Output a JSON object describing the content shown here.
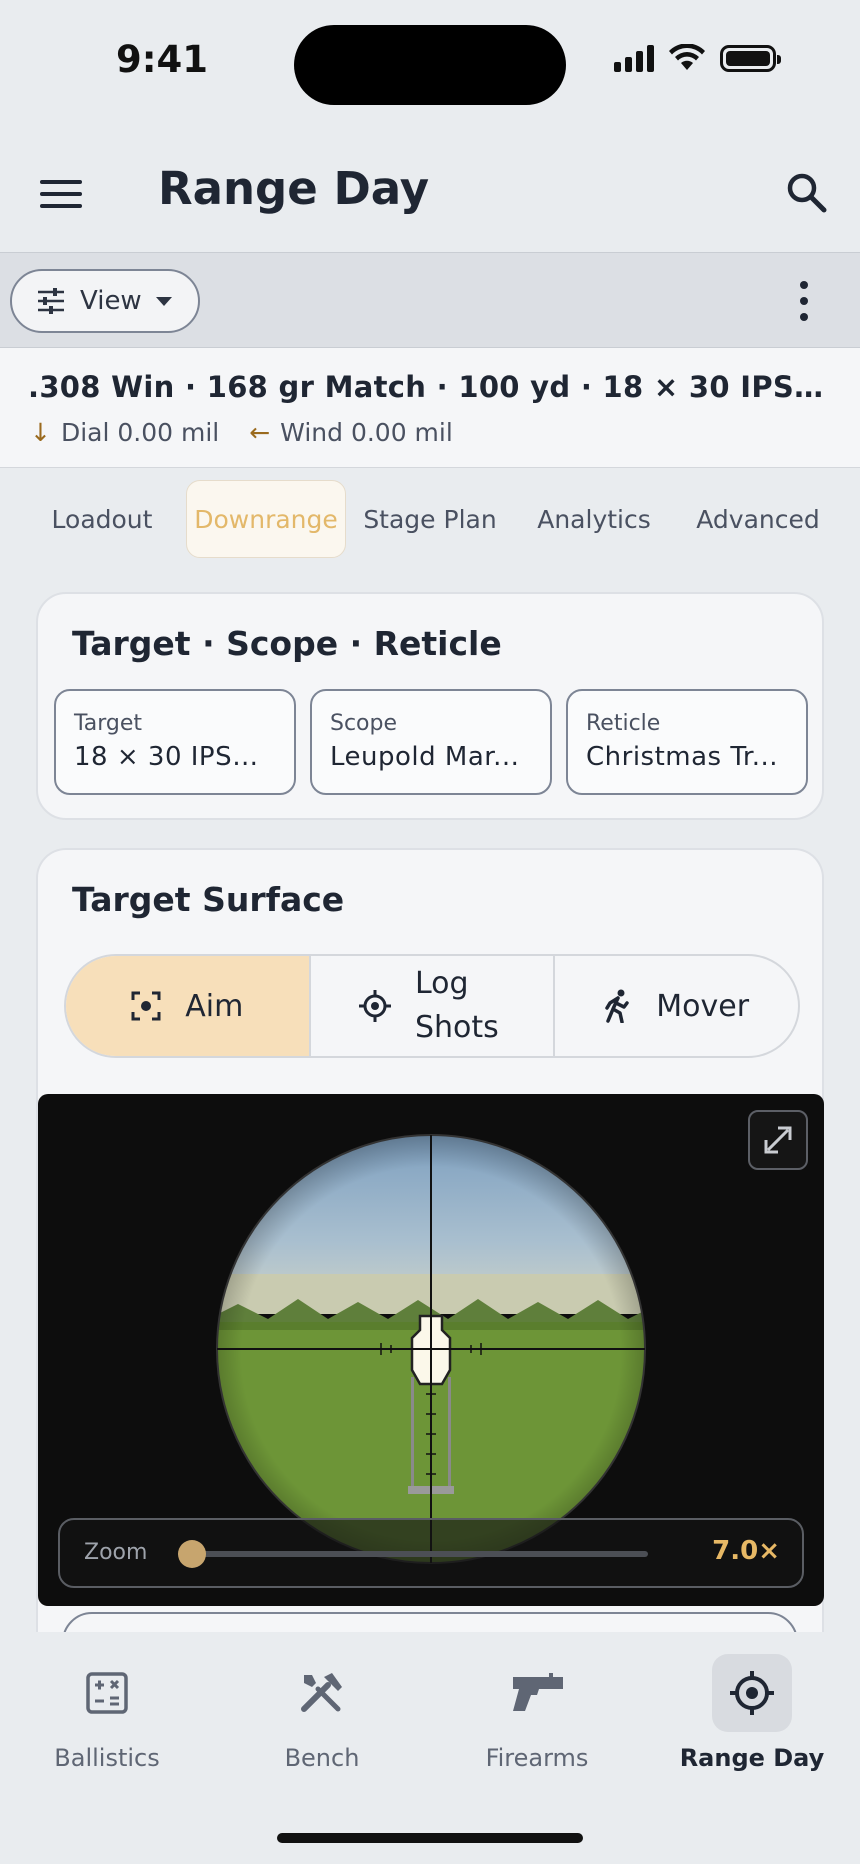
{
  "status_bar": {
    "time": "9:41"
  },
  "app_bar": {
    "title": "Range Day"
  },
  "toolbar": {
    "view_label": "View"
  },
  "info": {
    "title": ".308 Win · 168 gr Match · 100 yd · 18 × 30 IPSC (U...",
    "dial": "Dial 0.00 mil",
    "wind": "Wind 0.00 mil",
    "dial_arrow": "↓",
    "wind_arrow": "←"
  },
  "tabs": [
    {
      "label": "Loadout",
      "active": false
    },
    {
      "label": "Downrange",
      "active": true
    },
    {
      "label": "Stage Plan",
      "active": false
    },
    {
      "label": "Analytics",
      "active": false
    },
    {
      "label": "Advanced",
      "active": false
    }
  ],
  "setup_card": {
    "title": "Target · Scope · Reticle",
    "chips": [
      {
        "label": "Target",
        "value": "18 × 30 IPSC..."
      },
      {
        "label": "Scope",
        "value": "Leupold Mar..."
      },
      {
        "label": "Reticle",
        "value": "Christmas Tr..."
      }
    ]
  },
  "surface_card": {
    "title": "Target Surface",
    "modes": [
      {
        "label": "Aim",
        "icon": "aim-icon",
        "active": true
      },
      {
        "label": "Log Shots",
        "icon": "crosshair-icon",
        "active": false
      },
      {
        "label": "Mover",
        "icon": "running-person-icon",
        "active": false
      }
    ],
    "zoom": {
      "label": "Zoom",
      "value": "7.0×",
      "fraction": 0.0
    }
  },
  "bottom_nav": [
    {
      "label": "Ballistics",
      "icon": "calculator-icon",
      "active": false
    },
    {
      "label": "Bench",
      "icon": "tools-icon",
      "active": false
    },
    {
      "label": "Firearms",
      "icon": "pistol-icon",
      "active": false
    },
    {
      "label": "Range Day",
      "icon": "target-icon",
      "active": true
    }
  ],
  "colors": {
    "accent": "#e3b86a",
    "active_segment": "#f7dfba",
    "background": "#e9ecef",
    "text": "#1f2633"
  }
}
